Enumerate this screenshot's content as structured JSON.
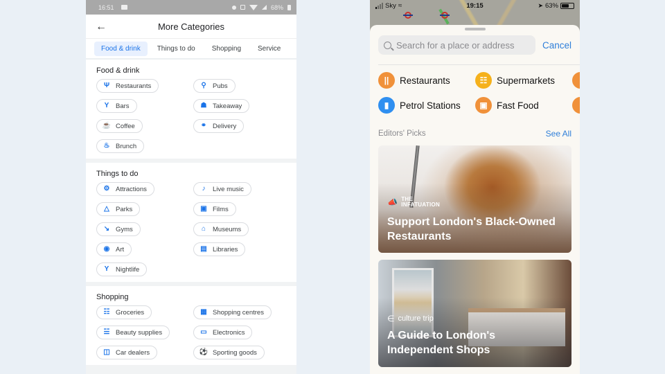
{
  "left_phone": {
    "status_bar": {
      "time": "16:51",
      "battery": "68%"
    },
    "header": {
      "back_icon": "arrow-left-icon",
      "title": "More Categories"
    },
    "tabs": [
      {
        "label": "Food & drink",
        "active": true
      },
      {
        "label": "Things to do",
        "active": false
      },
      {
        "label": "Shopping",
        "active": false
      },
      {
        "label": "Service",
        "active": false
      }
    ],
    "sections": [
      {
        "title": "Food & drink",
        "items": [
          {
            "label": "Restaurants",
            "icon": "restaurant-icon"
          },
          {
            "label": "Pubs",
            "icon": "search-icon"
          },
          {
            "label": "Bars",
            "icon": "cocktail-icon"
          },
          {
            "label": "Takeaway",
            "icon": "takeaway-icon"
          },
          {
            "label": "Coffee",
            "icon": "coffee-icon"
          },
          {
            "label": "Delivery",
            "icon": "delivery-icon"
          },
          {
            "label": "Brunch",
            "icon": "brunch-icon"
          }
        ]
      },
      {
        "title": "Things to do",
        "items": [
          {
            "label": "Attractions",
            "icon": "attractions-icon"
          },
          {
            "label": "Live music",
            "icon": "music-note-icon"
          },
          {
            "label": "Parks",
            "icon": "park-icon"
          },
          {
            "label": "Films",
            "icon": "film-icon"
          },
          {
            "label": "Gyms",
            "icon": "gym-icon"
          },
          {
            "label": "Museums",
            "icon": "museum-icon"
          },
          {
            "label": "Art",
            "icon": "palette-icon"
          },
          {
            "label": "Libraries",
            "icon": "library-icon"
          },
          {
            "label": "Nightlife",
            "icon": "nightlife-icon"
          }
        ]
      },
      {
        "title": "Shopping",
        "items": [
          {
            "label": "Groceries",
            "icon": "cart-icon"
          },
          {
            "label": "Shopping centres",
            "icon": "store-icon"
          },
          {
            "label": "Beauty supplies",
            "icon": "beauty-icon"
          },
          {
            "label": "Electronics",
            "icon": "devices-icon"
          },
          {
            "label": "Car dealers",
            "icon": "car-icon"
          },
          {
            "label": "Sporting goods",
            "icon": "sports-icon"
          }
        ]
      }
    ]
  },
  "right_phone": {
    "status_bar": {
      "carrier": "Sky",
      "time": "19:15",
      "battery": "63%"
    },
    "search": {
      "placeholder": "Search for a place or address",
      "cancel_label": "Cancel"
    },
    "categories": [
      {
        "label": "Restaurants",
        "icon": "fork-knife-icon",
        "color": "#f0913a"
      },
      {
        "label": "Supermarkets",
        "icon": "basket-icon",
        "color": "#f5b11c"
      },
      {
        "label": "",
        "icon": "partial-icon",
        "color": "#f0913a"
      },
      {
        "label": "Petrol Stations",
        "icon": "fuel-pump-icon",
        "color": "#2f8ff0"
      },
      {
        "label": "Fast Food",
        "icon": "fast-food-icon",
        "color": "#f0913a"
      },
      {
        "label": "",
        "icon": "partial-icon",
        "color": "#f0913a"
      }
    ],
    "editors_picks": {
      "title": "Editors' Picks",
      "see_all_label": "See All",
      "cards": [
        {
          "brand": "THE INFATUATION",
          "title": "Support London's Black-Owned Restaurants"
        },
        {
          "brand": "culture trip",
          "title": "A Guide to London's Independent Shops"
        }
      ]
    }
  }
}
